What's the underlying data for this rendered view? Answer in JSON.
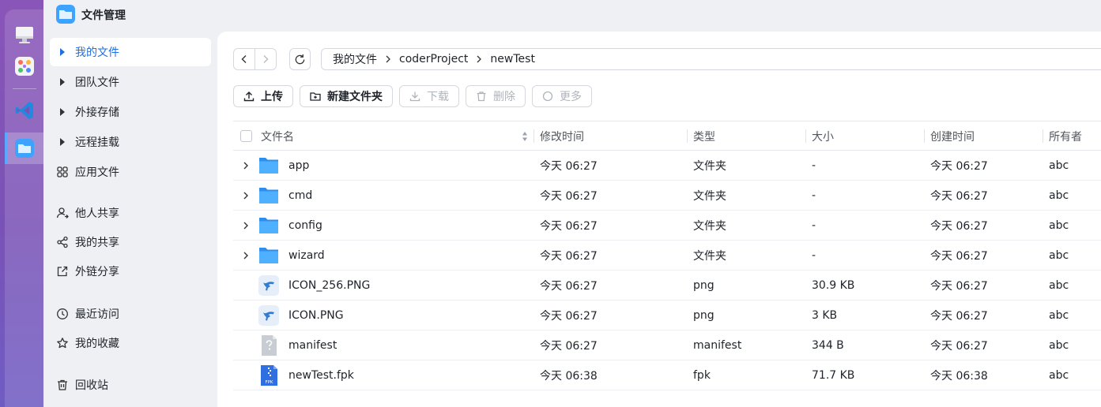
{
  "app": {
    "title": "文件管理"
  },
  "sidebar": {
    "items": [
      {
        "label": "我的文件",
        "icon": "caret-right-icon",
        "active": true
      },
      {
        "label": "团队文件",
        "icon": "caret-right-icon"
      },
      {
        "label": "外接存储",
        "icon": "caret-right-icon"
      },
      {
        "label": "远程挂载",
        "icon": "caret-right-icon"
      },
      {
        "label": "应用文件",
        "icon": "apps-grid-icon"
      },
      {
        "label": "他人共享",
        "icon": "person-share-icon"
      },
      {
        "label": "我的共享",
        "icon": "share-icon"
      },
      {
        "label": "外链分享",
        "icon": "external-link-icon"
      },
      {
        "label": "最近访问",
        "icon": "clock-icon"
      },
      {
        "label": "我的收藏",
        "icon": "star-icon"
      },
      {
        "label": "回收站",
        "icon": "trash-icon"
      }
    ]
  },
  "breadcrumb": [
    "我的文件",
    "coderProject",
    "newTest"
  ],
  "toolbar": {
    "upload": "上传",
    "new_folder": "新建文件夹",
    "download": "下载",
    "delete": "删除",
    "more": "更多"
  },
  "table": {
    "columns": [
      "文件名",
      "修改时间",
      "类型",
      "大小",
      "创建时间",
      "所有者"
    ],
    "rows": [
      {
        "name": "app",
        "modified": "今天 06:27",
        "type": "文件夹",
        "size": "-",
        "created": "今天 06:27",
        "owner": "abc",
        "kind": "folder"
      },
      {
        "name": "cmd",
        "modified": "今天 06:27",
        "type": "文件夹",
        "size": "-",
        "created": "今天 06:27",
        "owner": "abc",
        "kind": "folder"
      },
      {
        "name": "config",
        "modified": "今天 06:27",
        "type": "文件夹",
        "size": "-",
        "created": "今天 06:27",
        "owner": "abc",
        "kind": "folder"
      },
      {
        "name": "wizard",
        "modified": "今天 06:27",
        "type": "文件夹",
        "size": "-",
        "created": "今天 06:27",
        "owner": "abc",
        "kind": "folder"
      },
      {
        "name": "ICON_256.PNG",
        "modified": "今天 06:27",
        "type": "png",
        "size": "30.9 KB",
        "created": "今天 06:27",
        "owner": "abc",
        "kind": "image"
      },
      {
        "name": "ICON.PNG",
        "modified": "今天 06:27",
        "type": "png",
        "size": "3 KB",
        "created": "今天 06:27",
        "owner": "abc",
        "kind": "image"
      },
      {
        "name": "manifest",
        "modified": "今天 06:27",
        "type": "manifest",
        "size": "344 B",
        "created": "今天 06:27",
        "owner": "abc",
        "kind": "unknown"
      },
      {
        "name": "newTest.fpk",
        "modified": "今天 06:38",
        "type": "fpk",
        "size": "71.7 KB",
        "created": "今天 06:38",
        "owner": "abc",
        "kind": "fpk",
        "badge": "FPK"
      }
    ]
  },
  "colors": {
    "accent": "#1e6fe5",
    "folder": "#3da3ff",
    "dock": "#7a52b6"
  }
}
